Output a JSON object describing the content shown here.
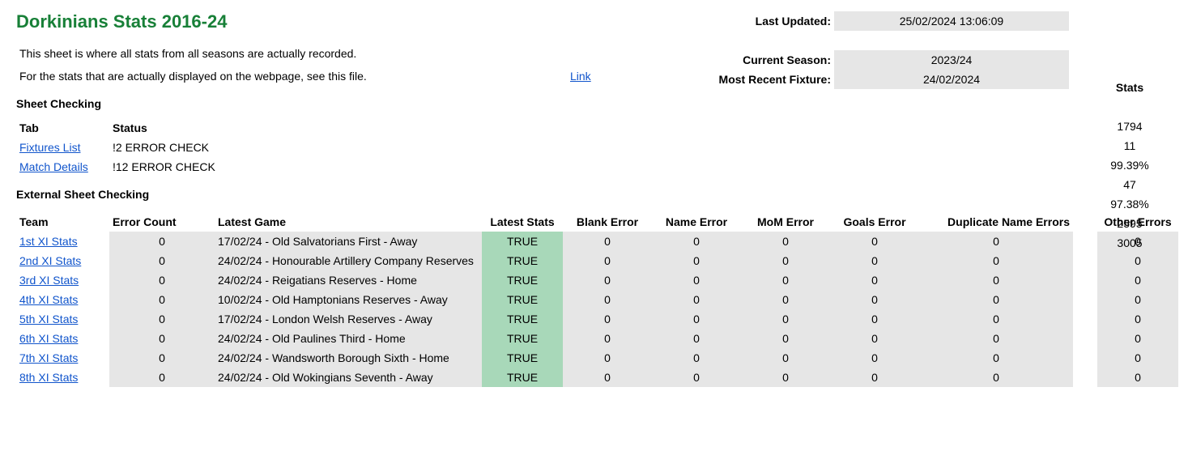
{
  "title": "Dorkinians Stats 2016-24",
  "intro_line1": "This sheet is where all stats from all seasons are actually recorded.",
  "intro_line2": "For the stats that are actually displayed on the webpage, see this file.",
  "link_label": "Link",
  "meta": {
    "last_updated_label": "Last Updated:",
    "last_updated_value": "25/02/2024 13:06:09",
    "current_season_label": "Current Season:",
    "current_season_value": "2023/24",
    "most_recent_fixture_label": "Most Recent Fixture:",
    "most_recent_fixture_value": "24/02/2024"
  },
  "stats_label": "Stats",
  "stats_values": [
    "1794",
    "11",
    "99.39%",
    "47",
    "97.38%",
    "2595",
    "3005"
  ],
  "sheet_checking_label": "Sheet Checking",
  "tab_headers": {
    "tab": "Tab",
    "status": "Status"
  },
  "tab_rows": [
    {
      "tab": "Fixtures List",
      "status": "!2 ERROR CHECK"
    },
    {
      "tab": "Match Details",
      "status": "!12 ERROR CHECK"
    }
  ],
  "external_label": "External Sheet Checking",
  "ext_headers": {
    "team": "Team",
    "error_count": "Error Count",
    "latest_game": "Latest Game",
    "latest_stats": "Latest Stats",
    "blank_error": "Blank Error",
    "name_error": "Name Error",
    "mom_error": "MoM Error",
    "goals_error": "Goals Error",
    "dup_name": "Duplicate Name Errors",
    "other": "Other Errors"
  },
  "ext_rows": [
    {
      "team": "1st XI Stats",
      "err": "0",
      "game": "17/02/24 - Old Salvatorians First - Away",
      "stats": "TRUE",
      "blank": "0",
      "name": "0",
      "mom": "0",
      "goals": "0",
      "dup": "0",
      "other": "0"
    },
    {
      "team": "2nd XI Stats",
      "err": "0",
      "game": "24/02/24 - Honourable Artillery Company Reserves",
      "stats": "TRUE",
      "blank": "0",
      "name": "0",
      "mom": "0",
      "goals": "0",
      "dup": "0",
      "other": "0"
    },
    {
      "team": "3rd XI Stats",
      "err": "0",
      "game": "24/02/24 - Reigatians Reserves - Home",
      "stats": "TRUE",
      "blank": "0",
      "name": "0",
      "mom": "0",
      "goals": "0",
      "dup": "0",
      "other": "0"
    },
    {
      "team": "4th XI Stats",
      "err": "0",
      "game": "10/02/24 - Old Hamptonians Reserves - Away",
      "stats": "TRUE",
      "blank": "0",
      "name": "0",
      "mom": "0",
      "goals": "0",
      "dup": "0",
      "other": "0"
    },
    {
      "team": "5th XI Stats",
      "err": "0",
      "game": "17/02/24 - London Welsh Reserves - Away",
      "stats": "TRUE",
      "blank": "0",
      "name": "0",
      "mom": "0",
      "goals": "0",
      "dup": "0",
      "other": "0"
    },
    {
      "team": "6th XI Stats",
      "err": "0",
      "game": "24/02/24 - Old Paulines Third - Home",
      "stats": "TRUE",
      "blank": "0",
      "name": "0",
      "mom": "0",
      "goals": "0",
      "dup": "0",
      "other": "0"
    },
    {
      "team": "7th XI Stats",
      "err": "0",
      "game": "24/02/24 - Wandsworth Borough Sixth - Home",
      "stats": "TRUE",
      "blank": "0",
      "name": "0",
      "mom": "0",
      "goals": "0",
      "dup": "0",
      "other": "0"
    },
    {
      "team": "8th XI Stats",
      "err": "0",
      "game": "24/02/24 - Old Wokingians Seventh - Away",
      "stats": "TRUE",
      "blank": "0",
      "name": "0",
      "mom": "0",
      "goals": "0",
      "dup": "0",
      "other": "0"
    }
  ]
}
